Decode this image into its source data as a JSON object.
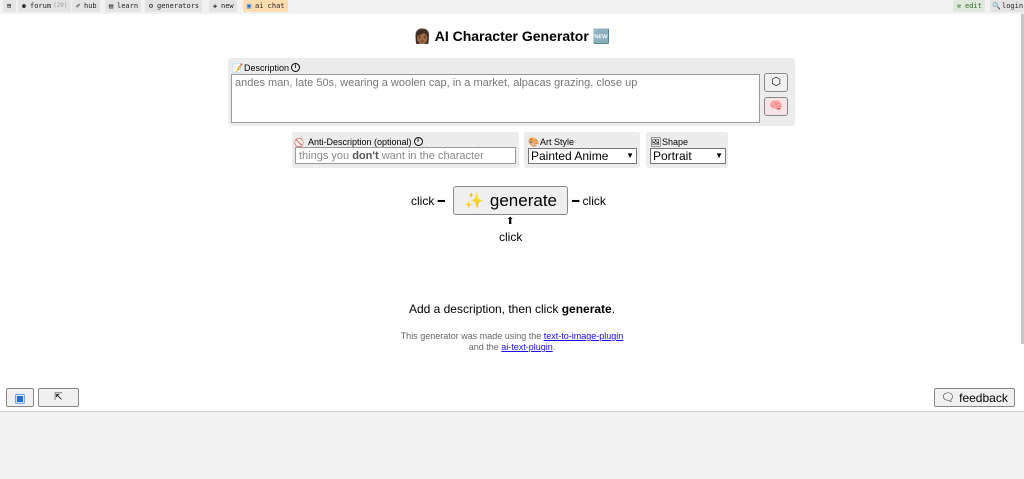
{
  "nav": {
    "left": [
      {
        "icon": "⊞",
        "label": ""
      },
      {
        "icon": "⚉",
        "label": "forum",
        "sub": "(20)"
      },
      {
        "icon": "✐",
        "label": "hub"
      },
      {
        "icon": "▤",
        "label": "learn"
      },
      {
        "icon": "⚙",
        "label": "generators"
      },
      {
        "icon": "✚",
        "label": "new"
      },
      {
        "icon": "▣",
        "label": "ai chat"
      }
    ],
    "right": [
      {
        "icon": "⚒",
        "label": "edit"
      },
      {
        "icon": "🔍",
        "label": "login"
      }
    ]
  },
  "title": "👩🏾 AI Character Generator 🆕",
  "description": {
    "label": "Description",
    "value": "andes man, late 50s, wearing a woolen cap, in a market, alpacas grazing, close up"
  },
  "anti_description": {
    "label": "Anti-Description (optional)",
    "placeholder_pre": "things you ",
    "placeholder_bold": "don't",
    "placeholder_post": " want in the character"
  },
  "art_style": {
    "label": "Art Style",
    "selected": "Painted Anime"
  },
  "shape": {
    "label": "Shape",
    "selected": "Portrait"
  },
  "generate": {
    "label": "generate",
    "click_left": "click ━",
    "click_right": "━ click",
    "click_below_arrow": "⬆",
    "click_below": "click"
  },
  "hint": {
    "pre": "Add a description, then click ",
    "bold": "generate",
    "post": "."
  },
  "made_with": {
    "line1_pre": "This generator was made using the ",
    "link1": "text-to-image-plugin",
    "line2_pre": "and the ",
    "link2": "ai-text-plugin",
    "line2_post": "."
  },
  "footer": {
    "feedback": "feedback"
  }
}
